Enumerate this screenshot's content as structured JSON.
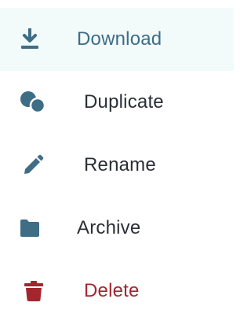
{
  "menu": {
    "items": [
      {
        "id": "download",
        "label": "Download",
        "icon": "download-icon",
        "active": true,
        "color": "#3e6d86"
      },
      {
        "id": "duplicate",
        "label": "Duplicate",
        "icon": "duplicate-icon",
        "active": false,
        "color": "#2b2f36"
      },
      {
        "id": "rename",
        "label": "Rename",
        "icon": "pencil-icon",
        "active": false,
        "color": "#2b2f36"
      },
      {
        "id": "archive",
        "label": "Archive",
        "icon": "folder-icon",
        "active": false,
        "color": "#2b2f36"
      },
      {
        "id": "delete",
        "label": "Delete",
        "icon": "trash-icon",
        "active": false,
        "color": "#a3262f"
      }
    ]
  },
  "colors": {
    "icon": "#3e6d86",
    "danger": "#a3262f",
    "text": "#2b2f36",
    "active_background": "#f2fafa"
  }
}
